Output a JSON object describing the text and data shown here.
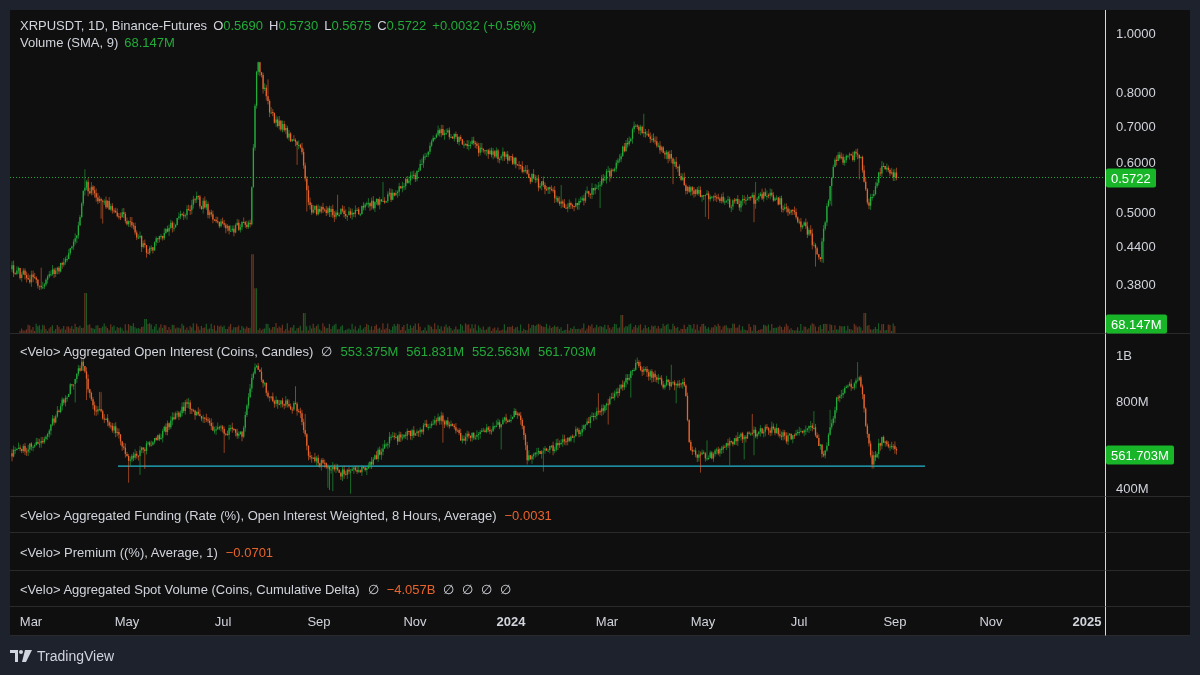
{
  "main_pane": {
    "legend": {
      "symbol": "XRPUSDT, 1D, Binance-Futures",
      "ohlc": [
        {
          "label": "O",
          "value": "0.5690"
        },
        {
          "label": "H",
          "value": "0.5730"
        },
        {
          "label": "L",
          "value": "0.5675"
        },
        {
          "label": "C",
          "value": "0.5722"
        }
      ],
      "change": "+0.0032 (+0.56%)"
    },
    "volume_legend": {
      "name": "Volume (SMA, 9)",
      "value": "68.147M"
    },
    "price_axis": [
      "1.0000",
      "0.8000",
      "0.7000",
      "0.6000",
      "0.5000",
      "0.4400",
      "0.3800"
    ],
    "last_price": "0.5722",
    "volume_badge": "68.147M"
  },
  "indicators": [
    {
      "title": "<Velo> Aggregated Open Interest (Coins, Candles)",
      "values": [
        {
          "text": "∅",
          "kind": "na"
        },
        {
          "text": "553.375M",
          "kind": "up"
        },
        {
          "text": "561.831M",
          "kind": "up"
        },
        {
          "text": "552.563M",
          "kind": "up"
        },
        {
          "text": "561.703M",
          "kind": "up"
        }
      ],
      "axis": [
        "1B",
        "800M",
        "400M"
      ],
      "badge": "561.703M"
    },
    {
      "title": "<Velo> Aggregated Funding (Rate (%), Open Interest Weighted, 8 Hours, Average)",
      "values": [
        {
          "text": "−0.0031",
          "kind": "down"
        }
      ]
    },
    {
      "title": "<Velo> Premium ((%), Average, 1)",
      "values": [
        {
          "text": "−0.0701",
          "kind": "down"
        }
      ]
    },
    {
      "title": "<Velo> Aggregated Spot Volume (Coins, Cumulative Delta)",
      "values": [
        {
          "text": "∅",
          "kind": "na"
        },
        {
          "text": "−4.057B",
          "kind": "down"
        },
        {
          "text": "∅",
          "kind": "na"
        },
        {
          "text": "∅",
          "kind": "na"
        },
        {
          "text": "∅",
          "kind": "na"
        },
        {
          "text": "∅",
          "kind": "na"
        }
      ]
    }
  ],
  "time_axis": [
    {
      "label": "Mar",
      "kind": "month"
    },
    {
      "label": "May",
      "kind": "month"
    },
    {
      "label": "Jul",
      "kind": "month"
    },
    {
      "label": "Sep",
      "kind": "month"
    },
    {
      "label": "Nov",
      "kind": "month"
    },
    {
      "label": "2024",
      "kind": "year"
    },
    {
      "label": "Mar",
      "kind": "month"
    },
    {
      "label": "May",
      "kind": "month"
    },
    {
      "label": "Jul",
      "kind": "month"
    },
    {
      "label": "Sep",
      "kind": "month"
    },
    {
      "label": "Nov",
      "kind": "month"
    },
    {
      "label": "2025",
      "kind": "year"
    }
  ],
  "footer": {
    "brand": "TradingView"
  }
}
